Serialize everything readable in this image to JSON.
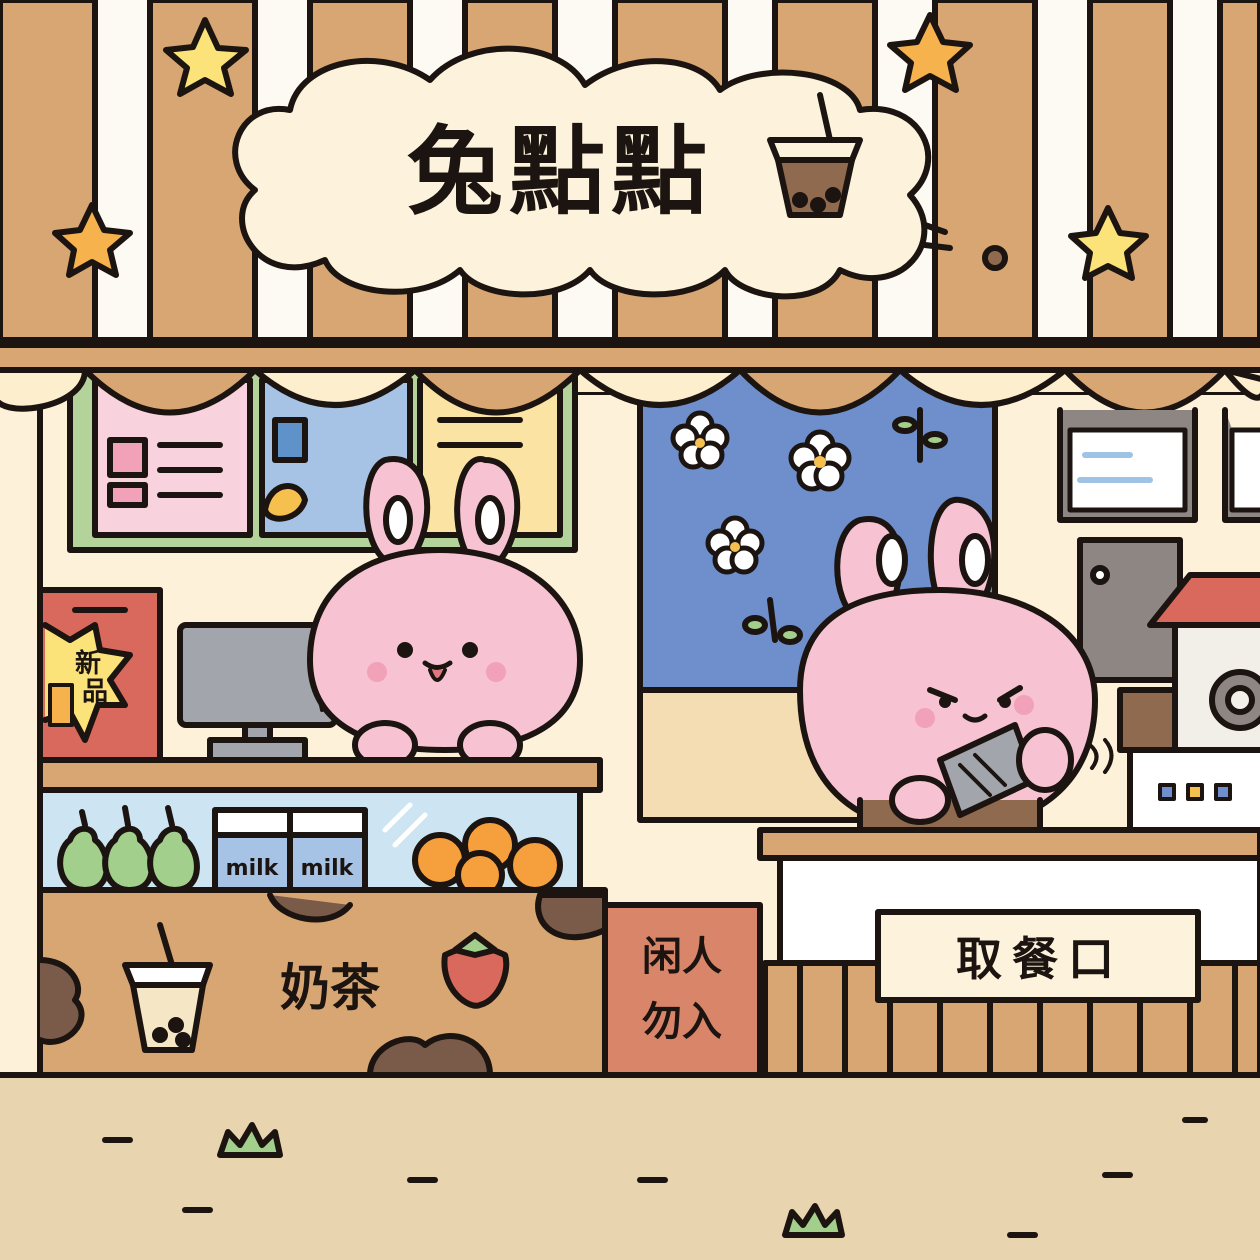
{
  "shop_sign": {
    "name": "兔點點"
  },
  "counter": {
    "label": "奶茶"
  },
  "badge": {
    "text_line1": "新",
    "text_line2": "品"
  },
  "milk_cartons": [
    {
      "label": "milk"
    },
    {
      "label": "milk"
    }
  ],
  "staff_sign": {
    "line1": "闲人",
    "line2": "勿入"
  },
  "pickup_sign": {
    "label": "取餐口"
  },
  "colors": {
    "outline": "#1c1410",
    "wood": "#d7a673",
    "cream": "#fdf1d9",
    "bunny_pink": "#f7c3d3",
    "window_blue": "#6e8fcb",
    "ground": "#e9d4b0"
  }
}
